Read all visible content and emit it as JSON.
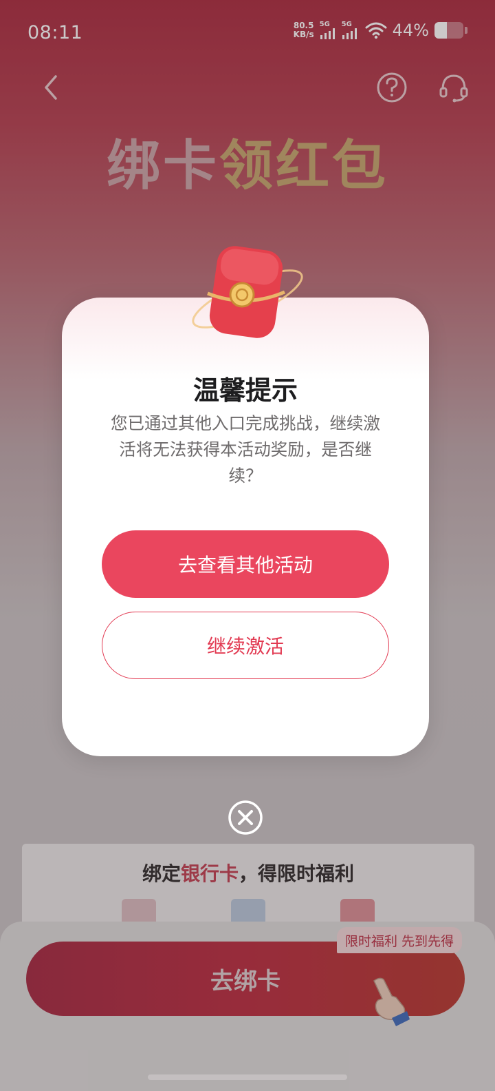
{
  "status_bar": {
    "time": "08:11",
    "net_speed_value": "80.5",
    "net_speed_unit": "KB/s",
    "sim1_label": "5G",
    "sim2_label": "5G",
    "battery_percent_text": "44%",
    "battery_level": 0.44
  },
  "nav": {
    "back_icon": "chevron-left-icon",
    "help_icon": "question-circle-icon",
    "service_icon": "headset-icon"
  },
  "hero": {
    "title_part1": "绑卡",
    "title_part2": "领红包"
  },
  "modal": {
    "title": "温馨提示",
    "message": "您已通过其他入口完成挑战，继续激活将无法获得本活动奖励，是否继续？",
    "primary_button": "去查看其他活动",
    "secondary_button": "继续激活",
    "close_icon": "close-circle-icon",
    "illustration": "red-envelope-icon"
  },
  "bottom_card": {
    "title_prefix": "绑定",
    "title_highlight": "银行卡",
    "title_suffix": "，得限时福利"
  },
  "bottom_bar": {
    "bind_button": "去绑卡",
    "promo_tag": "限时福利 先到先得"
  },
  "colors": {
    "accent": "#ea465e",
    "brand_red": "#b8263b"
  }
}
